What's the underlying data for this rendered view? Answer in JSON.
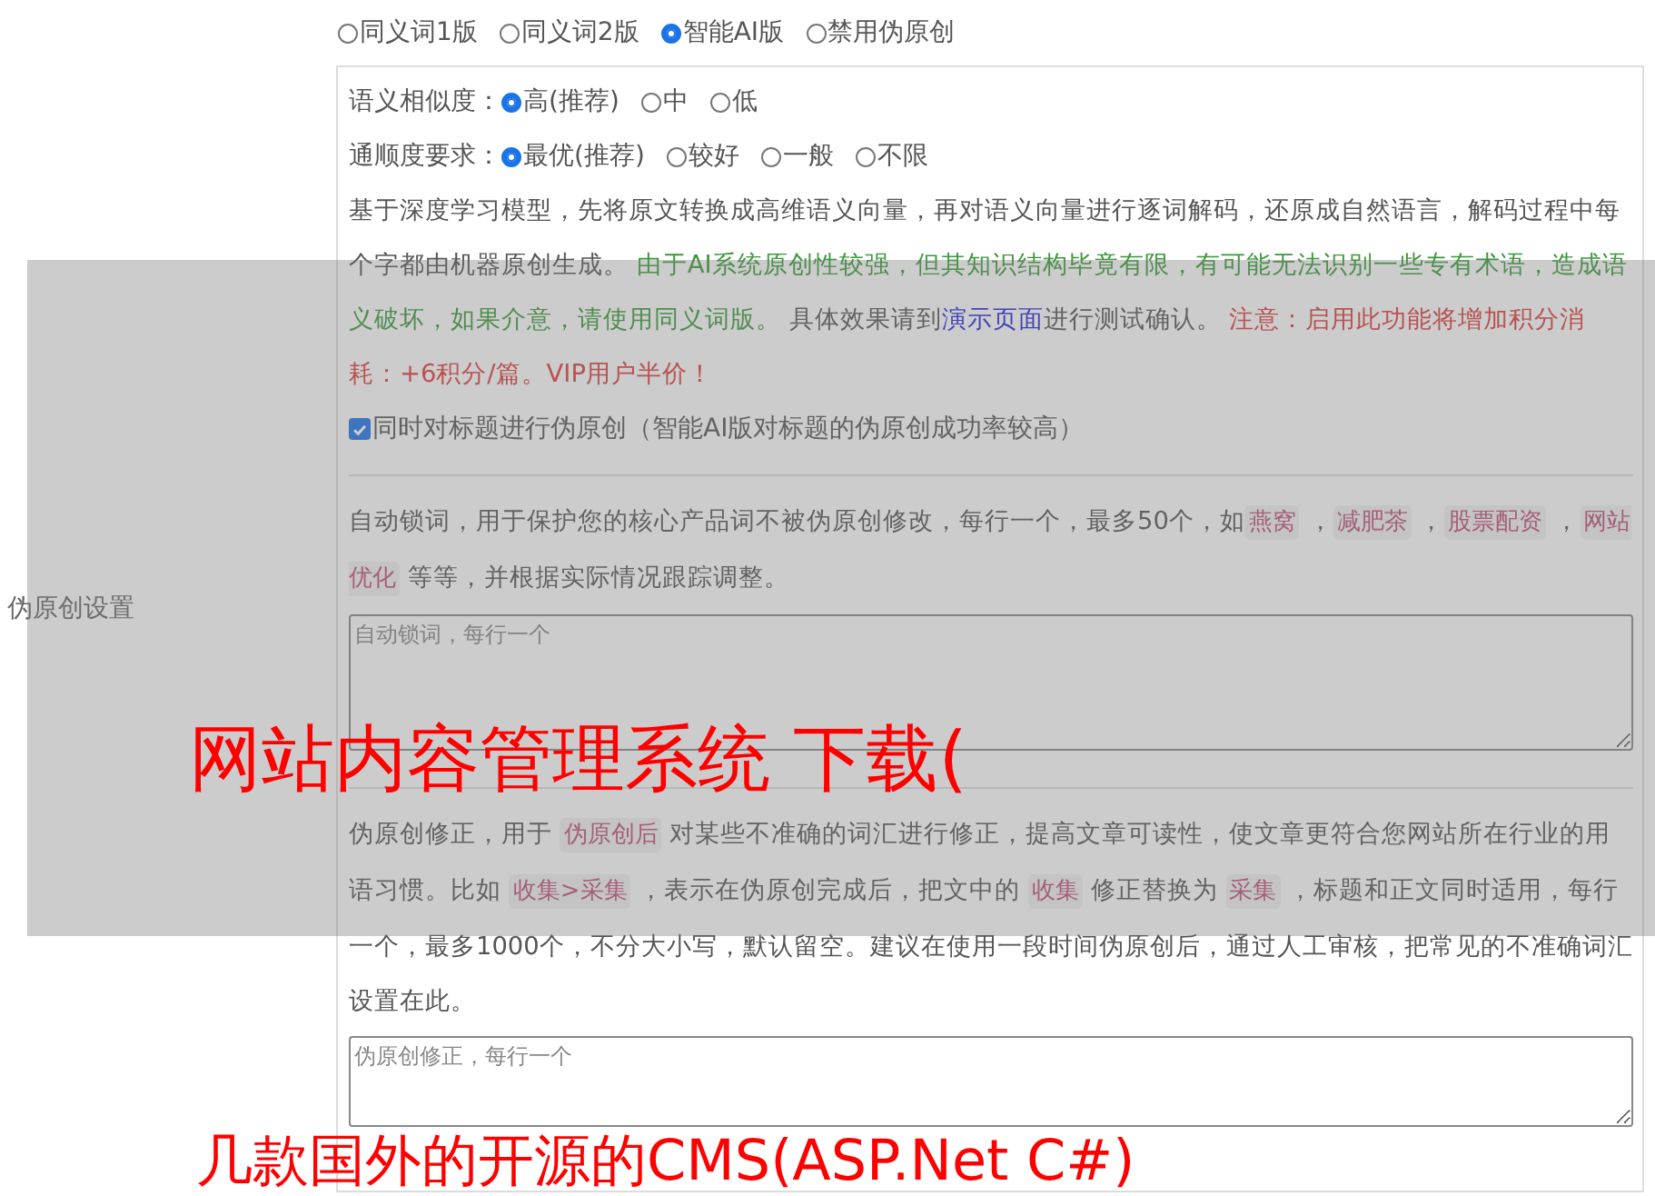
{
  "section_label": "伪原创设置",
  "modes": [
    {
      "label": "同义词1版",
      "selected": false
    },
    {
      "label": "同义词2版",
      "selected": false
    },
    {
      "label": "智能AI版",
      "selected": true
    },
    {
      "label": "禁用伪原创",
      "selected": false
    }
  ],
  "similarity": {
    "label": "语义相似度：",
    "options": [
      {
        "label": "高(推荐)",
        "selected": true
      },
      {
        "label": "中",
        "selected": false
      },
      {
        "label": "低",
        "selected": false
      }
    ]
  },
  "fluency": {
    "label": "通顺度要求：",
    "options": [
      {
        "label": "最优(推荐)",
        "selected": true
      },
      {
        "label": "较好",
        "selected": false
      },
      {
        "label": "一般",
        "selected": false
      },
      {
        "label": "不限",
        "selected": false
      }
    ]
  },
  "description": [
    {
      "kind": "plain",
      "text": "基于深度学习模型，先将原文转换成高维语义向量，再对语义向量进行逐词解码，还原成自然语言，解码过程中每个字都由机器原创生成。 "
    },
    {
      "kind": "notice",
      "text": "由于AI系统原创性较强，但其知识结构毕竟有限，有可能无法识别一些专有术语，造成语义破坏，如果介意，请使用同义词版。"
    },
    {
      "kind": "plain",
      "text": " 具体效果请到"
    },
    {
      "kind": "link",
      "text": "演示页面"
    },
    {
      "kind": "plain",
      "text": "进行测试确认。 "
    },
    {
      "kind": "warning",
      "text": "注意：启用此功能将增加积分消耗：+6积分/篇。VIP用户半价！"
    }
  ],
  "title_option": {
    "label": "同时对标题进行伪原创（智能AI版对标题的伪原创成功率较高）",
    "checked": true
  },
  "lock_words": {
    "segments": [
      {
        "kind": "plain",
        "text": "自动锁词，用于保护您的核心产品词不被伪原创修改，每行一个，最多50个，如"
      },
      {
        "kind": "tag",
        "text": "燕窝"
      },
      {
        "kind": "plain",
        "text": " ，"
      },
      {
        "kind": "tag",
        "text": "减肥茶"
      },
      {
        "kind": "plain",
        "text": " ，"
      },
      {
        "kind": "tag",
        "text": "股票配资"
      },
      {
        "kind": "plain",
        "text": " ，"
      },
      {
        "kind": "tag",
        "text": "网站优化"
      },
      {
        "kind": "plain",
        "text": " 等等，并根据实际情况跟踪调整。"
      }
    ],
    "placeholder": "自动锁词，每行一个"
  },
  "corrections": {
    "segments": [
      {
        "kind": "plain",
        "text": "伪原创修正，用于 "
      },
      {
        "kind": "tag",
        "text": "伪原创后"
      },
      {
        "kind": "plain",
        "text": " 对某些不准确的词汇进行修正，提高文章可读性，使文章更符合您网站所在行业的用语习惯。比如 "
      },
      {
        "kind": "tag",
        "text": "收集>采集"
      },
      {
        "kind": "plain",
        "text": " ，表示在伪原创完成后，把文中的 "
      },
      {
        "kind": "tag",
        "text": "收集"
      },
      {
        "kind": "plain",
        "text": " 修正替换为 "
      },
      {
        "kind": "tag",
        "text": "采集"
      },
      {
        "kind": "plain",
        "text": " ，标题和正文同时适用，每行一个，最多1000个，不分大小写，默认留空。建议在使用一段时间伪原创后，通过人工审核，把常见的不准确词汇设置在此。"
      }
    ],
    "placeholder": "伪原创修正，每行一个"
  },
  "overlay_texts": [
    "网站内容管理系统 下载(",
    "几款国外的开源的CMS(ASP.Net C#)"
  ]
}
